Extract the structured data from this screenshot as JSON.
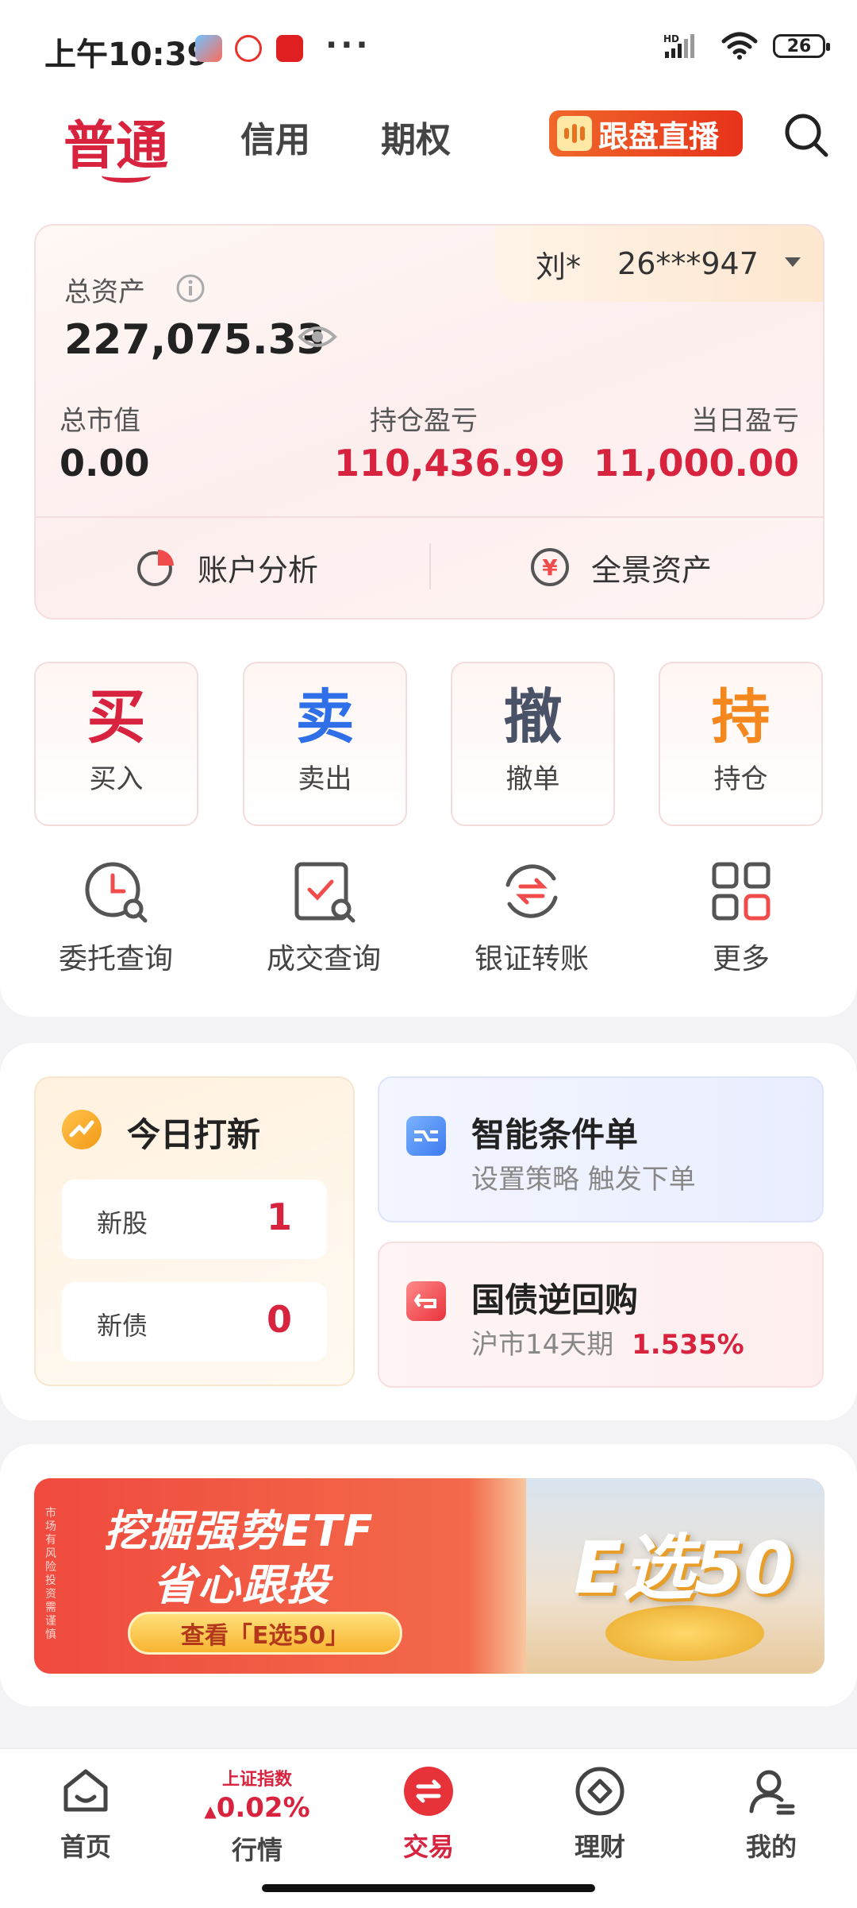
{
  "status_bar": {
    "time": "上午10:39",
    "more": "···",
    "battery": "26"
  },
  "header": {
    "tabs": [
      {
        "label": "普通",
        "active": true
      },
      {
        "label": "信用",
        "active": false
      },
      {
        "label": "期权",
        "active": false
      }
    ],
    "live_label": "跟盘直播"
  },
  "account": {
    "user": "刘*",
    "account_no": "26***947",
    "total_assets_label": "总资产",
    "total_assets": "227,075.33",
    "market_value_label": "总市值",
    "market_value": "0.00",
    "position_pnl_label": "持仓盈亏",
    "position_pnl": "110,436.99",
    "daily_pnl_label": "当日盈亏",
    "daily_pnl": "11,000.00",
    "analysis_label": "账户分析",
    "panorama_label": "全景资产",
    "panorama_icon_glyph": "¥"
  },
  "trade_buttons": [
    {
      "big": "买",
      "label": "买入",
      "color": "#d8233f"
    },
    {
      "big": "卖",
      "label": "卖出",
      "color": "#2f6fe8"
    },
    {
      "big": "撤",
      "label": "撤单",
      "color": "#4a5268"
    },
    {
      "big": "持",
      "label": "持仓",
      "color": "#f5871f"
    }
  ],
  "tools": [
    {
      "label": "委托查询",
      "icon": "clock-search-icon"
    },
    {
      "label": "成交查询",
      "icon": "check-search-icon"
    },
    {
      "label": "银证转账",
      "icon": "transfer-icon"
    },
    {
      "label": "更多",
      "icon": "grid-icon"
    }
  ],
  "ipo": {
    "title": "今日打新",
    "rows": [
      {
        "label": "新股",
        "value": "1"
      },
      {
        "label": "新债",
        "value": "0"
      }
    ]
  },
  "features": [
    {
      "title": "智能条件单",
      "subtitle": "设置策略 触发下单",
      "extra": ""
    },
    {
      "title": "国债逆回购",
      "subtitle": "沪市14天期",
      "extra": "1.535%"
    }
  ],
  "banner": {
    "line1": "挖掘强势ETF",
    "line2": "省心跟投",
    "button": "查看「E选50」",
    "side_note": "市场有风险 投资需谨慎",
    "brand": "E选50"
  },
  "bottom_nav": {
    "items": [
      {
        "label": "首页",
        "active": false
      },
      {
        "label": "行情",
        "active": false
      },
      {
        "label": "交易",
        "active": true
      },
      {
        "label": "理财",
        "active": false
      },
      {
        "label": "我的",
        "active": false
      }
    ],
    "index_name": "上证指数",
    "index_change": "0.02%",
    "index_arrow": "▲"
  }
}
